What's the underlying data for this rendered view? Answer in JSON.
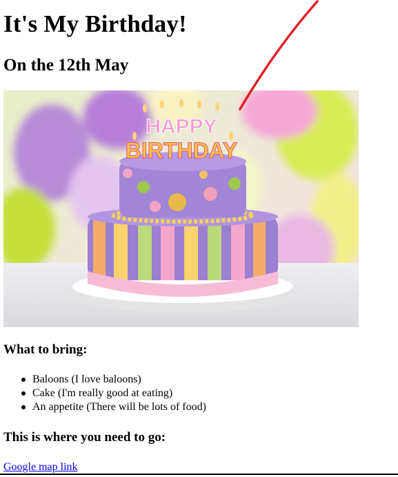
{
  "page": {
    "title": "It's My Birthday!",
    "date": "On the 12th May"
  },
  "image": {
    "topper_line1": "HAPPY",
    "topper_line2": "BIRTHDAY",
    "icon": "birthday-cake-photo"
  },
  "bring": {
    "heading": "What to bring:",
    "items": [
      "Baloons (I love baloons)",
      "Cake (I'm really good at eating)",
      "An appetite (There will be lots of food)"
    ]
  },
  "directions": {
    "heading": "This is where you need to go:",
    "link_label": "Google map link"
  },
  "colors": {
    "link": "#0000ee",
    "annotation": "#e0202a"
  }
}
